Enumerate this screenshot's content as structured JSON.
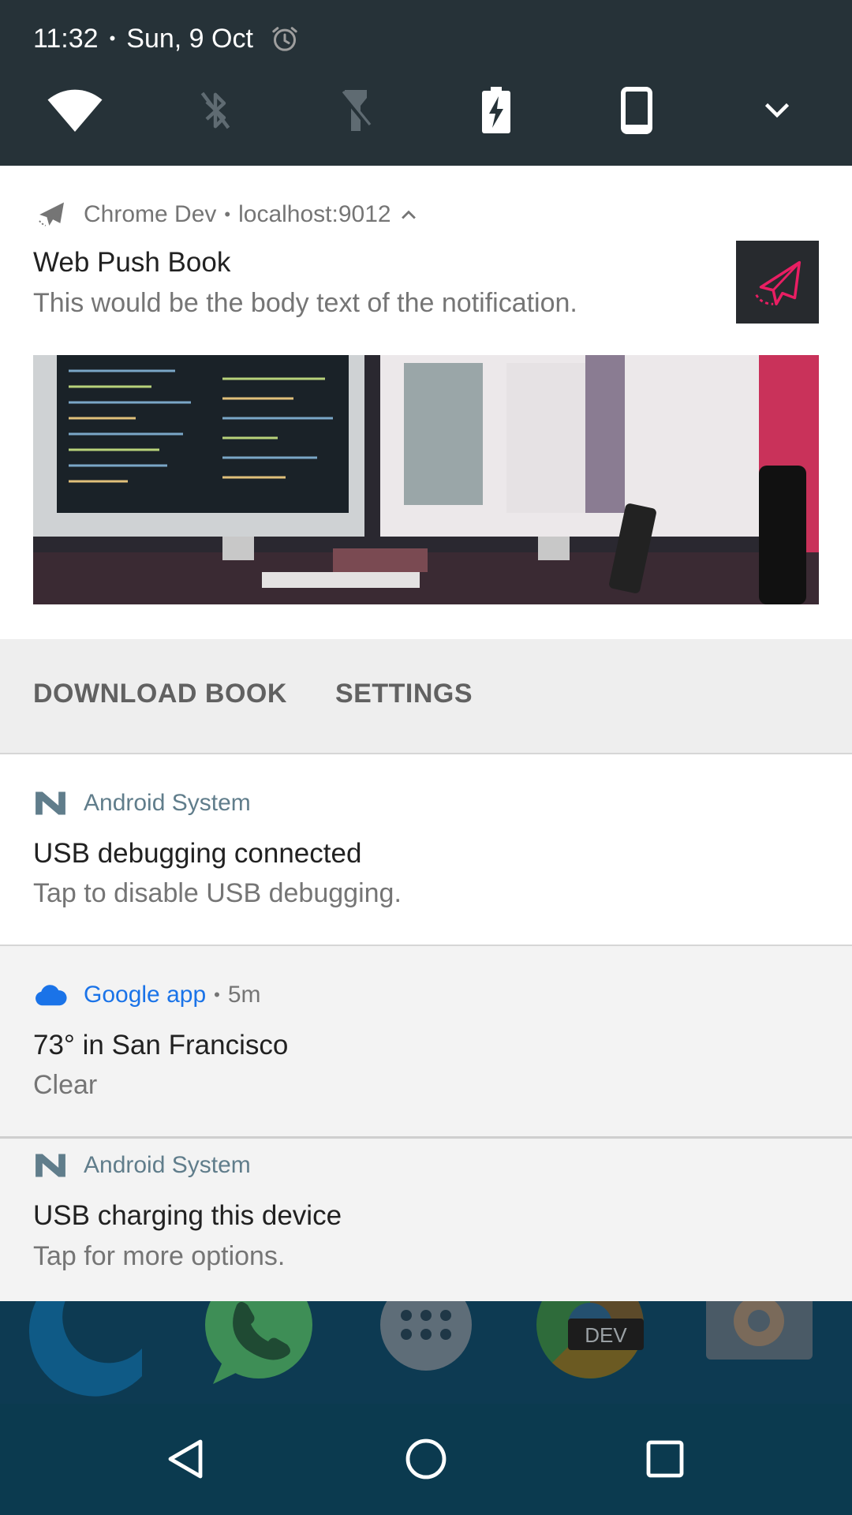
{
  "status": {
    "time": "11:32",
    "date": "Sun, 9 Oct",
    "alarm_icon": "alarm-icon"
  },
  "quick_settings": [
    {
      "name": "wifi-icon",
      "enabled": true
    },
    {
      "name": "bluetooth-off-icon",
      "enabled": false
    },
    {
      "name": "flashlight-off-icon",
      "enabled": false
    },
    {
      "name": "battery-charging-icon",
      "enabled": true
    },
    {
      "name": "auto-rotate-icon",
      "enabled": true
    },
    {
      "name": "chevron-down-icon",
      "enabled": true
    }
  ],
  "web_notification": {
    "app": "Chrome Dev",
    "origin": "localhost:9012",
    "title": "Web Push Book",
    "body": "This would be the body text of the notification.",
    "icon": "paper-plane-icon",
    "actions": [
      "DOWNLOAD BOOK",
      "SETTINGS"
    ]
  },
  "usb_debugging": {
    "app": "Android System",
    "title": "USB debugging connected",
    "body": "Tap to disable USB debugging."
  },
  "google_weather": {
    "app": "Google app",
    "time": "5m",
    "title": "73° in San Francisco",
    "body": "Clear"
  },
  "usb_charging": {
    "app": "Android System",
    "title": "USB charging this device",
    "body": "Tap for more options."
  },
  "dock": {
    "chrome_dev_badge": "DEV"
  },
  "colors": {
    "status_bg": "#263238",
    "android_system": "#607d8b",
    "google_blue": "#1a73e8",
    "accent_pink": "#e91e63"
  }
}
